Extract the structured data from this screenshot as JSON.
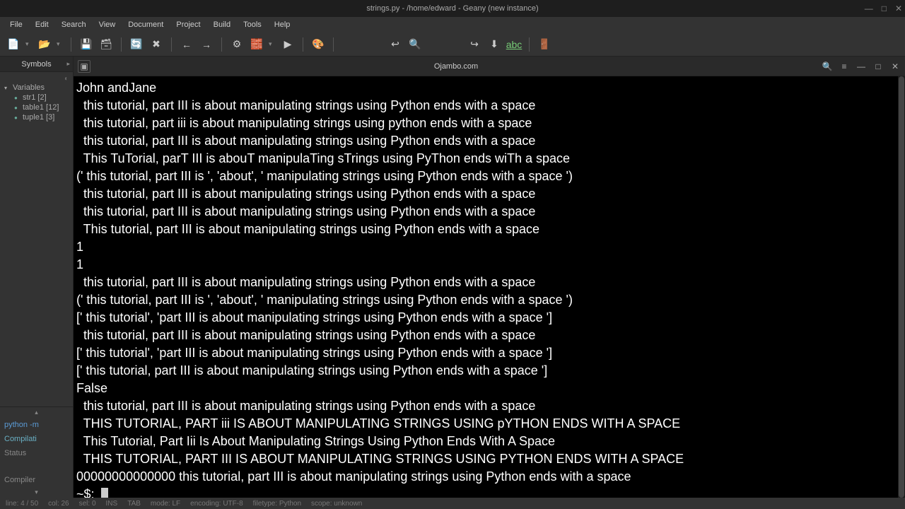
{
  "title": "strings.py - /home/edward - Geany (new instance)",
  "menu": [
    "File",
    "Edit",
    "Search",
    "View",
    "Document",
    "Project",
    "Build",
    "Tools",
    "Help"
  ],
  "sidebar": {
    "tab": "Symbols",
    "root": "Variables",
    "items": [
      "str1 [2]",
      "table1 [12]",
      "tuple1 [3]"
    ],
    "bottom_hl1": "python -m",
    "bottom_hl2": "Compilati",
    "status": "Status",
    "compiler": "Compiler"
  },
  "editor": {
    "tab_title": "Ojambo.com",
    "lines": [
      "John andJane",
      "  this tutorial, part III is about manipulating strings using Python ends with a space",
      "  this tutorial, part iii is about manipulating strings using python ends with a space",
      "  this tutorial, part III is about manipulating strings using Python ends with a space",
      "  This TuTorial, parT III is abouT manipulaTing sTrings using PyThon ends wiTh a space",
      "(' this tutorial, part III is ', 'about', ' manipulating strings using Python ends with a space ')",
      "  this tutorial, part III is about manipulating strings using Python ends with a space",
      "  this tutorial, part III is about manipulating strings using Python ends with a space",
      "  This tutorial, part III is about manipulating strings using Python ends with a space",
      "1",
      "1",
      "  this tutorial, part III is about manipulating strings using Python ends with a space",
      "(' this tutorial, part III is ', 'about', ' manipulating strings using Python ends with a space ')",
      "[' this tutorial', 'part III is about manipulating strings using Python ends with a space ']",
      "  this tutorial, part III is about manipulating strings using Python ends with a space",
      "[' this tutorial', 'part III is about manipulating strings using Python ends with a space ']",
      "[' this tutorial, part III is about manipulating strings using Python ends with a space ']",
      "False",
      "  this tutorial, part III is about manipulating strings using Python ends with a space",
      "  THIS TUTORIAL, PART iii IS ABOUT MANIPULATING STRINGS USING pYTHON ENDS WITH A SPACE",
      "  This Tutorial, Part Iii Is About Manipulating Strings Using Python Ends With A Space",
      "  THIS TUTORIAL, PART III IS ABOUT MANIPULATING STRINGS USING PYTHON ENDS WITH A SPACE",
      "00000000000000 this tutorial, part III is about manipulating strings using Python ends with a space"
    ],
    "prompt": "~$: "
  },
  "statusbar": {
    "line": "line: 4 / 50",
    "col": "col: 26",
    "sel": "sel: 0",
    "ins": "INS",
    "tab": "TAB",
    "mode": "mode: LF",
    "encoding": "encoding: UTF-8",
    "filetype": "filetype: Python",
    "scope": "scope: unknown"
  }
}
